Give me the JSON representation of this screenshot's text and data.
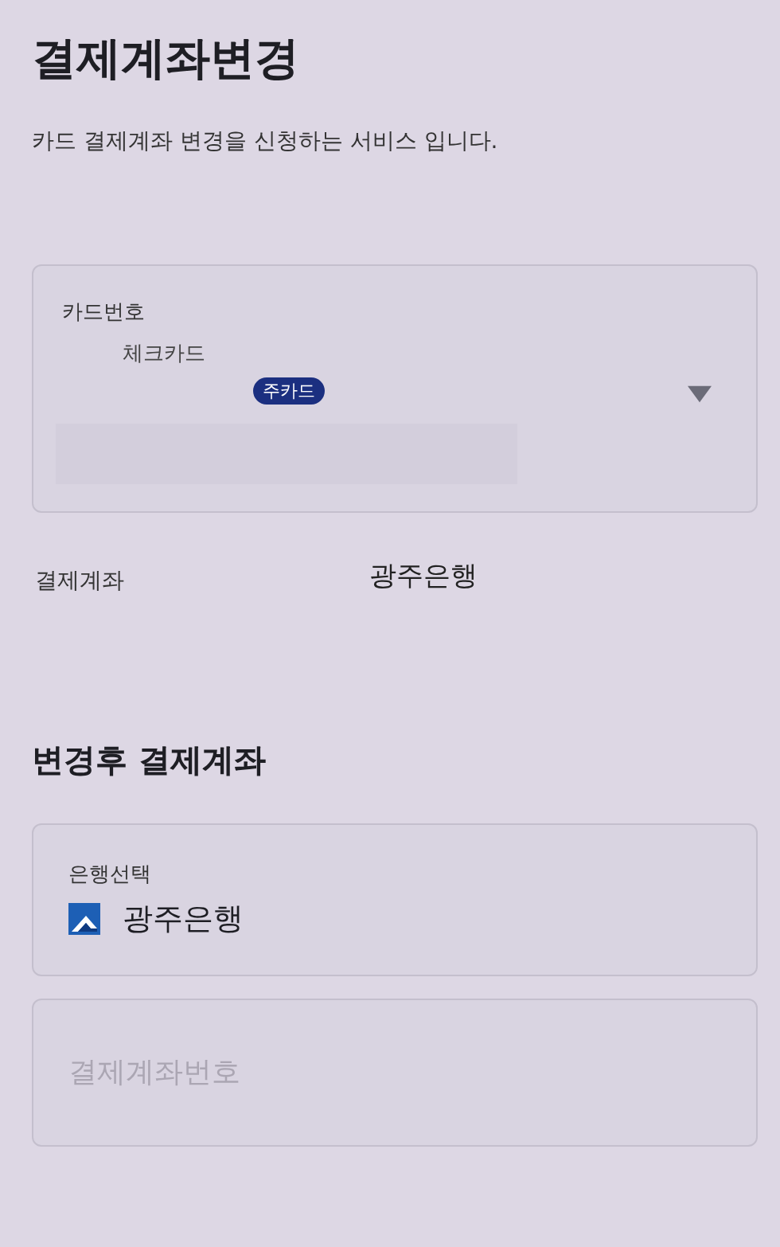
{
  "header": {
    "title": "결제계좌변경",
    "subtitle": "카드 결제계좌 변경을 신청하는 서비스 입니다."
  },
  "card_select": {
    "label": "카드번호",
    "card_type": "체크카드",
    "badge": "주카드"
  },
  "current_account": {
    "label": "결제계좌",
    "value": "광주은행"
  },
  "new_account": {
    "heading": "변경후 결제계좌",
    "bank_select": {
      "label": "은행선택",
      "value": "광주은행"
    },
    "account_field": {
      "placeholder": "결제계좌번호"
    }
  }
}
